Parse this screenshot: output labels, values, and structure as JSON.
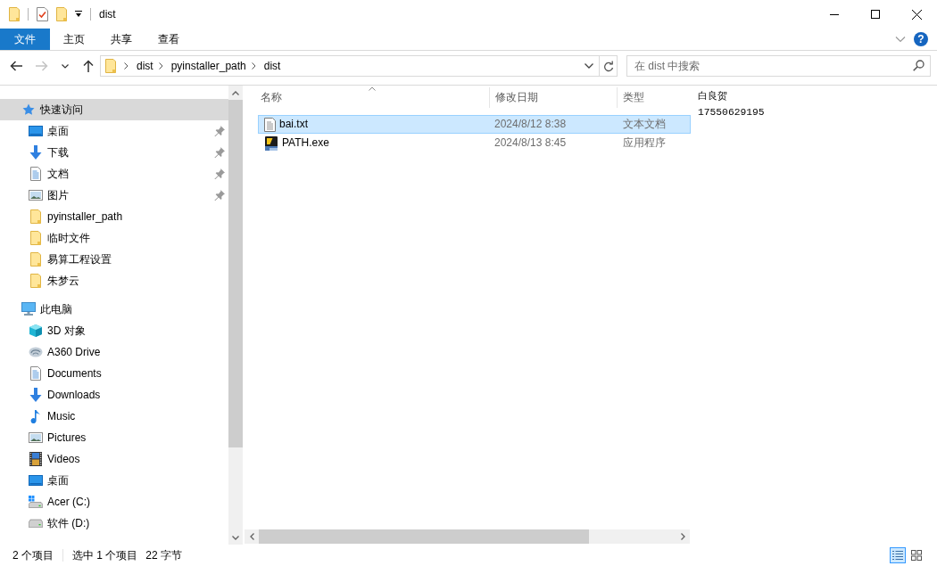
{
  "window": {
    "title": "dist"
  },
  "ribbon": {
    "tabs": [
      {
        "label": "文件",
        "kind": "file",
        "selected": false
      },
      {
        "label": "主页",
        "kind": "tab",
        "selected": false
      },
      {
        "label": "共享",
        "kind": "tab",
        "selected": false
      },
      {
        "label": "查看",
        "kind": "tab",
        "selected": false
      }
    ],
    "help": "?"
  },
  "navigation": {
    "buttons": [
      {
        "kind": "back",
        "disabled": false
      },
      {
        "kind": "forward",
        "disabled": true
      },
      {
        "kind": "recent",
        "disabled": false
      },
      {
        "kind": "up",
        "disabled": false
      }
    ],
    "breadcrumb": [
      {
        "label": "dist"
      },
      {
        "label": "pyinstaller_path"
      },
      {
        "label": "dist"
      }
    ],
    "search": {
      "placeholder": "在 dist 中搜索"
    }
  },
  "sidebar": {
    "items": [
      {
        "label": "快速访问",
        "kind": "star",
        "selected": true,
        "children": [
          {
            "label": "桌面",
            "kind": "desktop",
            "pinned": true,
            "selected": false
          },
          {
            "label": "下载",
            "kind": "download",
            "pinned": true,
            "selected": false
          },
          {
            "label": "文档",
            "kind": "document",
            "pinned": true,
            "selected": false
          },
          {
            "label": "图片",
            "kind": "picture",
            "pinned": true,
            "selected": false
          },
          {
            "label": "pyinstaller_path",
            "kind": "folder",
            "pinned": false,
            "selected": false
          },
          {
            "label": "临时文件",
            "kind": "folder",
            "pinned": false,
            "selected": false
          },
          {
            "label": "易算工程设置",
            "kind": "folder",
            "pinned": false,
            "selected": false
          },
          {
            "label": "朱梦云",
            "kind": "folder",
            "pinned": false,
            "selected": false
          }
        ]
      },
      {
        "label": "此电脑",
        "kind": "pc",
        "selected": false,
        "children": [
          {
            "label": "3D 对象",
            "kind": "cube",
            "selected": false
          },
          {
            "label": "A360 Drive",
            "kind": "cloud",
            "selected": false
          },
          {
            "label": "Documents",
            "kind": "document",
            "selected": false
          },
          {
            "label": "Downloads",
            "kind": "download",
            "selected": false
          },
          {
            "label": "Music",
            "kind": "music",
            "selected": false
          },
          {
            "label": "Pictures",
            "kind": "picture",
            "selected": false
          },
          {
            "label": "Videos",
            "kind": "video",
            "selected": false
          },
          {
            "label": "桌面",
            "kind": "desktop",
            "selected": false
          },
          {
            "label": "Acer (C:)",
            "kind": "system_drive",
            "selected": false
          },
          {
            "label": "软件 (D:)",
            "kind": "drive",
            "selected": false
          }
        ]
      }
    ]
  },
  "file_list": {
    "columns": [
      {
        "label": "名称",
        "sorted": true
      },
      {
        "label": "修改日期",
        "sorted": false
      },
      {
        "label": "类型",
        "sorted": false
      }
    ],
    "rows": [
      {
        "name": "bai.txt",
        "kind": "text",
        "modified": "2024/8/12 8:38",
        "type": "文本文档",
        "selected": true
      },
      {
        "name": "PATH.exe",
        "kind": "app",
        "modified": "2024/8/13 8:45",
        "type": "应用程序",
        "selected": false
      }
    ]
  },
  "preview": {
    "lines": [
      "白良贺",
      "17550629195"
    ]
  },
  "status_bar": {
    "item_count": "2 个项目",
    "selection": "选中 1 个项目",
    "size": "22 字节",
    "views": [
      {
        "kind": "details",
        "selected": true
      },
      {
        "kind": "large_icons",
        "selected": false
      }
    ]
  }
}
